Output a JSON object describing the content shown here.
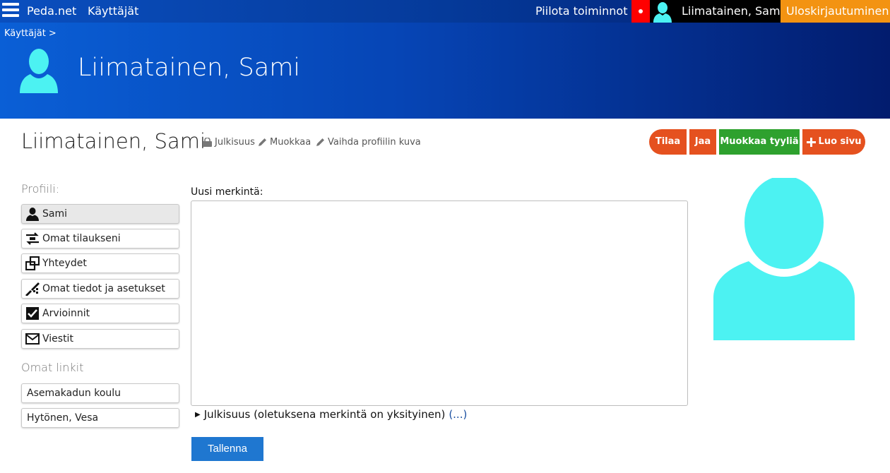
{
  "topbar": {
    "site_name": "Peda.net",
    "users_link": "Käyttäjät",
    "hide_actions": "Piilota toiminnot",
    "user_name": "Liimatainen, Sami",
    "logout": "Uloskirjautuminen",
    "record_color": "#ff0000",
    "logout_color": "#f39312"
  },
  "banner": {
    "breadcrumb": "Käyttäjät >",
    "title": "Liimatainen, Sami",
    "avatar_color": "#4cf2f2"
  },
  "header": {
    "title": "Liimatainen, Sami",
    "links": [
      {
        "label": "Julkisuus",
        "icon": "lock-icon"
      },
      {
        "label": "Muokkaa",
        "icon": "pencil-icon"
      },
      {
        "label": "Vaihda profiilin kuva",
        "icon": "pencil-icon"
      }
    ],
    "buttons": {
      "subscribe": "Tilaa",
      "share": "Jaa",
      "edit_style": "Muokkaa tyyliä",
      "create_page": "Luo sivu"
    }
  },
  "sidebar": {
    "profile_heading": "Profiili:",
    "items": [
      {
        "label": "Sami",
        "icon": "user-icon"
      },
      {
        "label": "Omat tilaukseni",
        "icon": "subscriptions-icon"
      },
      {
        "label": "Yhteydet",
        "icon": "connections-icon"
      },
      {
        "label": "Omat tiedot ja asetukset",
        "icon": "settings-tools-icon"
      },
      {
        "label": "Arvioinnit",
        "icon": "checkbox-icon"
      },
      {
        "label": "Viestit",
        "icon": "envelope-icon"
      }
    ],
    "links_heading": "Omat linkit",
    "links": [
      {
        "label": "Asemakadun koulu"
      },
      {
        "label": "Hytönen, Vesa"
      }
    ]
  },
  "form": {
    "label": "Uusi merkintä:",
    "textarea_value": "",
    "disclosure_label": "Julkisuus (oletuksena merkintä on yksityinen)",
    "disclosure_more": "(...)",
    "save": "Tallenna"
  }
}
